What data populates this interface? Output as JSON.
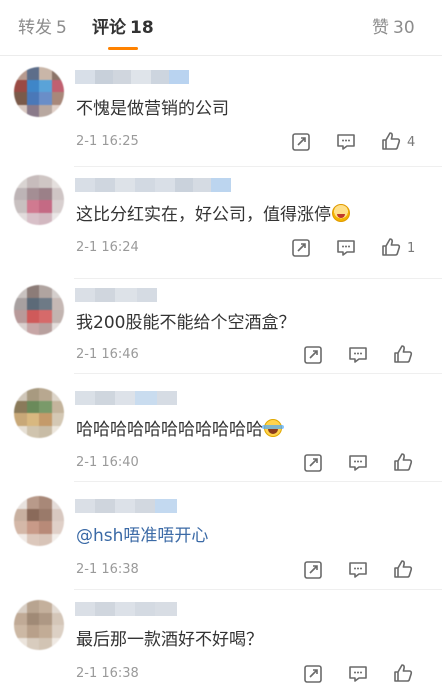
{
  "tabs": {
    "repost": {
      "label": "转发",
      "count": "5"
    },
    "comment": {
      "label": "评论",
      "count": "18"
    },
    "like": {
      "label": "赞",
      "count": "30"
    }
  },
  "comments": [
    {
      "text": "不愧是做营销的公司",
      "time": "2-1 16:25",
      "likes": "4"
    },
    {
      "text": "这比分红实在，好公司，值得涨停",
      "time": "2-1 16:24",
      "likes": "1"
    },
    {
      "text": "我200股能不能给个空酒盒？",
      "time": "2-1 16:46",
      "likes": ""
    },
    {
      "text": "哈哈哈哈哈哈哈哈哈哈哈",
      "time": "2-1 16:40",
      "likes": ""
    },
    {
      "text": "@hsh唔准唔开心",
      "time": "2-1 16:38",
      "likes": ""
    },
    {
      "text": "最后那一款酒好不好喝？",
      "time": "2-1 16:38",
      "likes": ""
    }
  ],
  "icons": {
    "repost": "repost-icon",
    "reply": "comment-icon",
    "like": "thumbs-up-icon"
  },
  "colors": {
    "accent": "#ff8200",
    "link": "#3b6aa6"
  }
}
